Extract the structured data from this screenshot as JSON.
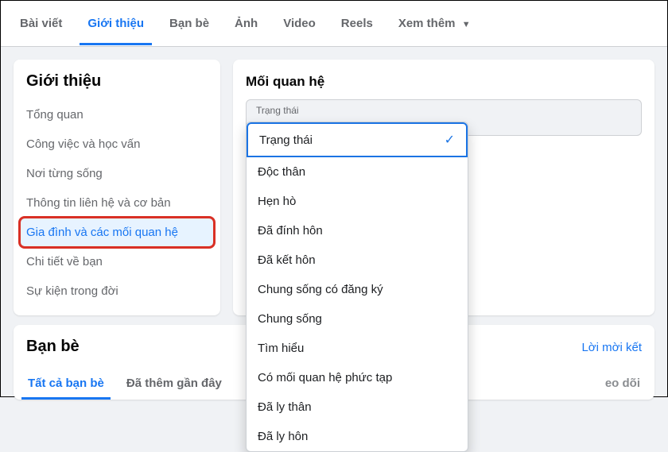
{
  "tabs": {
    "items": [
      {
        "label": "Bài viết"
      },
      {
        "label": "Giới thiệu"
      },
      {
        "label": "Bạn bè"
      },
      {
        "label": "Ảnh"
      },
      {
        "label": "Video"
      },
      {
        "label": "Reels"
      }
    ],
    "more": "Xem thêm",
    "active_index": 1
  },
  "sidebar": {
    "title": "Giới thiệu",
    "items": [
      {
        "label": "Tổng quan"
      },
      {
        "label": "Công việc và học vấn"
      },
      {
        "label": "Nơi từng sống"
      },
      {
        "label": "Thông tin liên hệ và cơ bản"
      },
      {
        "label": "Gia đình và các mối quan hệ"
      },
      {
        "label": "Chi tiết về bạn"
      },
      {
        "label": "Sự kiện trong đời"
      }
    ],
    "active_index": 4
  },
  "main": {
    "title": "Mối quan hệ",
    "status_field_label": "Trạng thái",
    "dropdown": {
      "selected_index": 0,
      "options": [
        "Trạng thái",
        "Độc thân",
        "Hẹn hò",
        "Đã đính hôn",
        "Đã kết hôn",
        "Chung sống có đăng ký",
        "Chung sống",
        "Tìm hiểu",
        "Có mối quan hệ phức tạp",
        "Đã ly thân",
        "Đã ly hôn"
      ]
    }
  },
  "friends": {
    "title": "Bạn bè",
    "link": "Lời mời kết",
    "tabs": [
      {
        "label": "Tất cả bạn bè"
      },
      {
        "label": "Đã thêm gần đây"
      },
      {
        "label": "eo dõi"
      }
    ],
    "active_tab": 0
  }
}
